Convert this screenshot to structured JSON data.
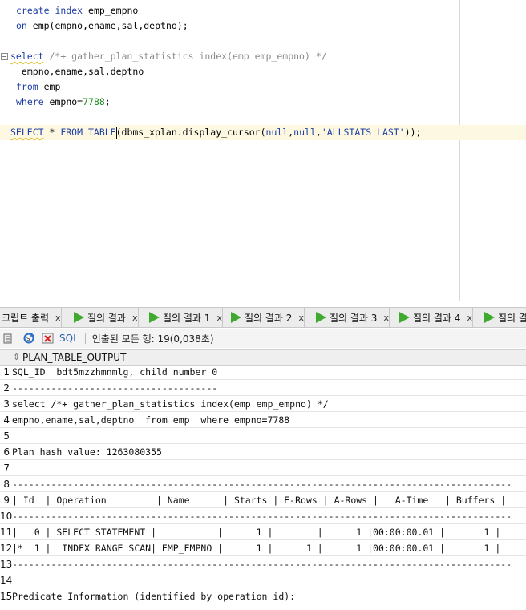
{
  "editor": {
    "lines": [
      [
        {
          "t": "create",
          "c": "kw"
        },
        {
          "t": " "
        },
        {
          "t": "index",
          "c": "kw"
        },
        {
          "t": " emp_empno"
        }
      ],
      [
        {
          "t": "on",
          "c": "kw"
        },
        {
          "t": " emp(empno,ename,sal,deptno);"
        }
      ],
      [],
      [
        {
          "t": "select",
          "c": "kw squig"
        },
        {
          "t": " "
        },
        {
          "t": "/*+ gather_plan_statistics index(emp emp_empno) */",
          "c": "cm"
        }
      ],
      [
        {
          "t": " empno,ename,sal,deptno"
        }
      ],
      [
        {
          "t": "from",
          "c": "kw"
        },
        {
          "t": " emp"
        }
      ],
      [
        {
          "t": "where",
          "c": "kw"
        },
        {
          "t": " empno="
        },
        {
          "t": "7788",
          "c": "num"
        },
        {
          "t": ";"
        }
      ],
      [],
      [
        {
          "t": "SELECT",
          "c": "kw squig"
        },
        {
          "t": " * "
        },
        {
          "t": "FROM",
          "c": "kw"
        },
        {
          "t": " "
        },
        {
          "t": "TABLE",
          "c": "kw"
        },
        {
          "t": "(dbms_xplan.display_cursor("
        },
        {
          "t": "null",
          "c": "kw"
        },
        {
          "t": ","
        },
        {
          "t": "null",
          "c": "kw"
        },
        {
          "t": ","
        },
        {
          "t": "'ALLSTATS LAST'",
          "c": "str"
        },
        {
          "t": "));"
        }
      ]
    ]
  },
  "tabs": [
    {
      "label": "크립트 출력",
      "play": false
    },
    {
      "label": "질의 결과",
      "play": true
    },
    {
      "label": "질의 결과 1",
      "play": true
    },
    {
      "label": "질의 결과 2",
      "play": true
    },
    {
      "label": "질의 결과 3",
      "play": true
    },
    {
      "label": "질의 결과 4",
      "play": true
    },
    {
      "label": "질의 결",
      "play": true
    }
  ],
  "tab_close_glyph": "x",
  "toolbar": {
    "sql_label": "SQL",
    "status": "인출된 모든 행: 19(0,038초)",
    "icons": [
      "pin-icon",
      "refresh-icon",
      "delete-icon"
    ]
  },
  "grid": {
    "column": "PLAN_TABLE_OUTPUT",
    "sort_glyph": "⇕",
    "rows": [
      {
        "n": "1",
        "text": "SQL_ID  bdt5mzzhmnmlg, child number 0"
      },
      {
        "n": "2",
        "text": "-------------------------------------"
      },
      {
        "n": "3",
        "text": "select /*+ gather_plan_statistics index(emp emp_empno) */"
      },
      {
        "n": "4",
        "text": "empno,ename,sal,deptno  from emp  where empno=7788"
      },
      {
        "n": "5",
        "text": ""
      },
      {
        "n": "6",
        "text": "Plan hash value: 1263080355"
      },
      {
        "n": "7",
        "text": ""
      },
      {
        "n": "8",
        "text": "------------------------------------------------------------------------------------------"
      },
      {
        "n": "9",
        "text": "| Id  | Operation         | Name      | Starts | E-Rows | A-Rows |   A-Time   | Buffers |"
      },
      {
        "n": "10",
        "text": "------------------------------------------------------------------------------------------"
      },
      {
        "n": "11",
        "text": "|   0 | SELECT STATEMENT |           |      1 |        |      1 |00:00:00.01 |       1 |"
      },
      {
        "n": "12",
        "text": "|*  1 |  INDEX RANGE SCAN| EMP_EMPNO |      1 |      1 |      1 |00:00:00.01 |       1 |"
      },
      {
        "n": "13",
        "text": "------------------------------------------------------------------------------------------"
      },
      {
        "n": "14",
        "text": ""
      },
      {
        "n": "15",
        "text": "Predicate Information (identified by operation id):"
      }
    ]
  },
  "colors": {
    "keyword": "#1d3fa5",
    "comment": "#8a8a8a",
    "number": "#1c8c1c",
    "current_line": "#fdf8e2",
    "tab_play": "#3faa2f"
  }
}
